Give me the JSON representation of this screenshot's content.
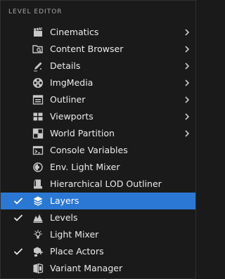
{
  "menu": {
    "section_title": "LEVEL EDITOR",
    "items": [
      {
        "label": "Cinematics",
        "icon": "clapperboard-icon",
        "submenu": true,
        "checked": false,
        "selected": false
      },
      {
        "label": "Content Browser",
        "icon": "folder-search-icon",
        "submenu": true,
        "checked": false,
        "selected": false
      },
      {
        "label": "Details",
        "icon": "pencil-icon",
        "submenu": true,
        "checked": false,
        "selected": false
      },
      {
        "label": "ImgMedia",
        "icon": "film-reel-icon",
        "submenu": true,
        "checked": false,
        "selected": false
      },
      {
        "label": "Outliner",
        "icon": "outliner-list-icon",
        "submenu": true,
        "checked": false,
        "selected": false
      },
      {
        "label": "Viewports",
        "icon": "viewports-grid-icon",
        "submenu": true,
        "checked": false,
        "selected": false
      },
      {
        "label": "World Partition",
        "icon": "world-partition-icon",
        "submenu": true,
        "checked": false,
        "selected": false
      },
      {
        "label": "Console Variables",
        "icon": "console-icon",
        "submenu": false,
        "checked": false,
        "selected": false
      },
      {
        "label": "Env. Light Mixer",
        "icon": "env-light-icon",
        "submenu": false,
        "checked": false,
        "selected": false
      },
      {
        "label": "Hierarchical LOD Outliner",
        "icon": "hlod-icon",
        "submenu": false,
        "checked": false,
        "selected": false
      },
      {
        "label": "Layers",
        "icon": "layers-icon",
        "submenu": false,
        "checked": true,
        "selected": true
      },
      {
        "label": "Levels",
        "icon": "levels-icon",
        "submenu": false,
        "checked": true,
        "selected": false
      },
      {
        "label": "Light Mixer",
        "icon": "light-bulb-icon",
        "submenu": false,
        "checked": false,
        "selected": false
      },
      {
        "label": "Place Actors",
        "icon": "place-actors-icon",
        "submenu": false,
        "checked": true,
        "selected": false
      },
      {
        "label": "Variant Manager",
        "icon": "variant-manager-icon",
        "submenu": false,
        "checked": false,
        "selected": false
      }
    ]
  },
  "colors": {
    "background": "#1a1a1a",
    "selected": "#2b78d4",
    "text": "#ececec",
    "header_text": "#a6a6a6",
    "icon": "#c8c8c8"
  }
}
